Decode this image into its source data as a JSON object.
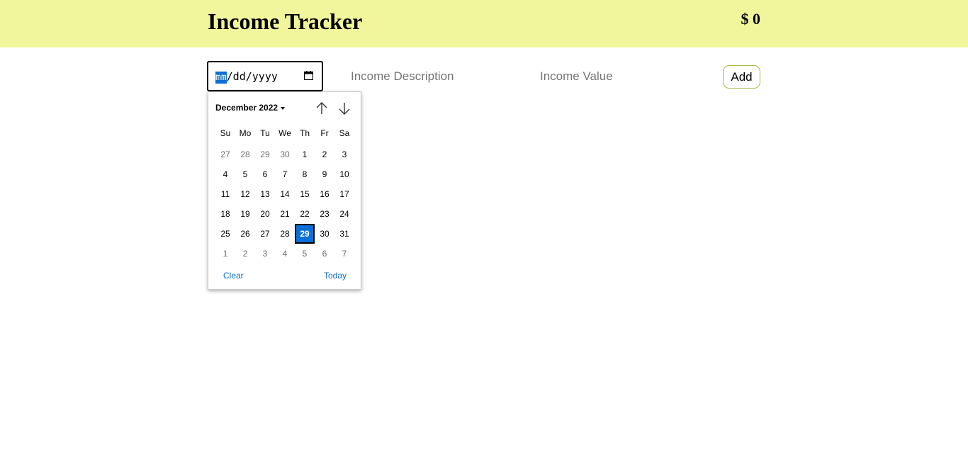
{
  "header": {
    "title": "Income Tracker",
    "total": "$ 0"
  },
  "form": {
    "date": {
      "month_segment": "mm",
      "rest": "/dd/yyyy",
      "icon": "calendar-icon"
    },
    "description_placeholder": "Income Description",
    "value_placeholder": "Income Value",
    "add_label": "Add"
  },
  "datepicker": {
    "month_label": "December 2022",
    "weekdays": [
      "Su",
      "Mo",
      "Tu",
      "We",
      "Th",
      "Fr",
      "Sa"
    ],
    "weeks": [
      [
        {
          "d": "27",
          "o": true
        },
        {
          "d": "28",
          "o": true
        },
        {
          "d": "29",
          "o": true
        },
        {
          "d": "30",
          "o": true
        },
        {
          "d": "1"
        },
        {
          "d": "2"
        },
        {
          "d": "3"
        }
      ],
      [
        {
          "d": "4"
        },
        {
          "d": "5"
        },
        {
          "d": "6"
        },
        {
          "d": "7"
        },
        {
          "d": "8"
        },
        {
          "d": "9"
        },
        {
          "d": "10"
        }
      ],
      [
        {
          "d": "11"
        },
        {
          "d": "12"
        },
        {
          "d": "13"
        },
        {
          "d": "14"
        },
        {
          "d": "15"
        },
        {
          "d": "16"
        },
        {
          "d": "17"
        }
      ],
      [
        {
          "d": "18"
        },
        {
          "d": "19"
        },
        {
          "d": "20"
        },
        {
          "d": "21"
        },
        {
          "d": "22"
        },
        {
          "d": "23"
        },
        {
          "d": "24"
        }
      ],
      [
        {
          "d": "25"
        },
        {
          "d": "26"
        },
        {
          "d": "27"
        },
        {
          "d": "28"
        },
        {
          "d": "29",
          "selected": true
        },
        {
          "d": "30"
        },
        {
          "d": "31"
        }
      ],
      [
        {
          "d": "1",
          "o": true
        },
        {
          "d": "2",
          "o": true
        },
        {
          "d": "3",
          "o": true
        },
        {
          "d": "4",
          "o": true
        },
        {
          "d": "5",
          "o": true
        },
        {
          "d": "6",
          "o": true
        },
        {
          "d": "7",
          "o": true
        }
      ]
    ],
    "clear_label": "Clear",
    "today_label": "Today",
    "nav_up_icon": "arrow-up-icon",
    "nav_down_icon": "arrow-down-icon"
  },
  "colors": {
    "header_bg": "#f1f59b",
    "accent": "#0b6fd6",
    "link": "#0b6bc2",
    "add_border": "#a8b84a"
  }
}
